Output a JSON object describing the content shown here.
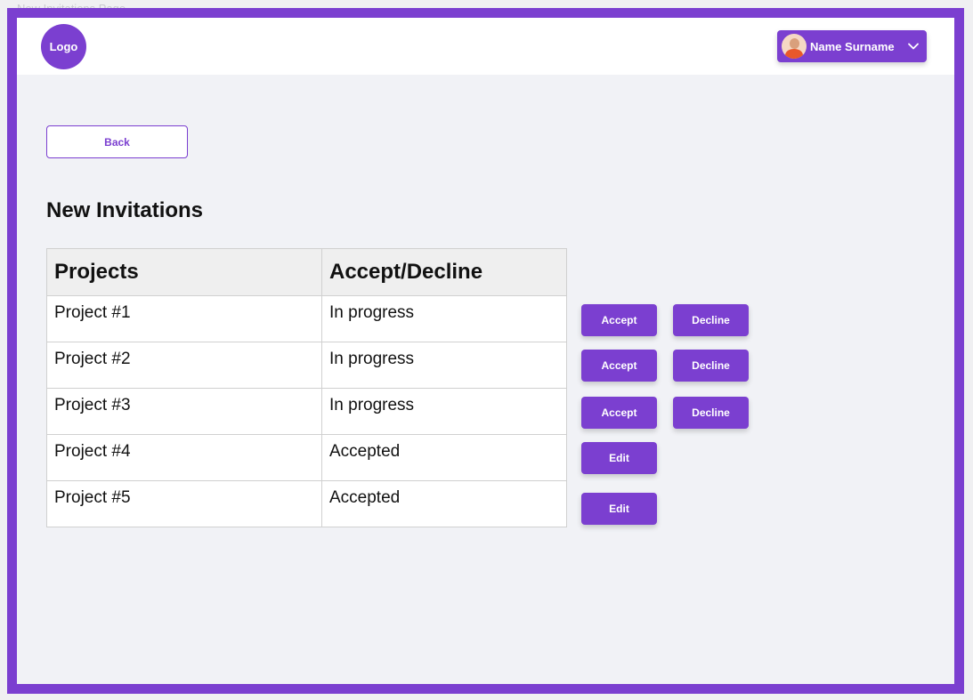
{
  "frame_caption": "New Invitations Page",
  "header": {
    "logo_text": "Logo",
    "user_name": "Name Surname"
  },
  "back_label": "Back",
  "page_title": "New Invitations",
  "table": {
    "headers": [
      "Projects",
      "Accept/Decline"
    ],
    "rows": [
      {
        "project": "Project #1",
        "status": "In progress"
      },
      {
        "project": "Project #2",
        "status": "In progress"
      },
      {
        "project": "Project #3",
        "status": "In progress"
      },
      {
        "project": "Project #4",
        "status": "Accepted"
      },
      {
        "project": "Project #5",
        "status": "Accepted"
      }
    ]
  },
  "actions": {
    "accept_label": "Accept",
    "decline_label": "Decline",
    "edit_label": "Edit"
  },
  "colors": {
    "accent": "#7b3fd0",
    "background": "#f1f2f6"
  }
}
